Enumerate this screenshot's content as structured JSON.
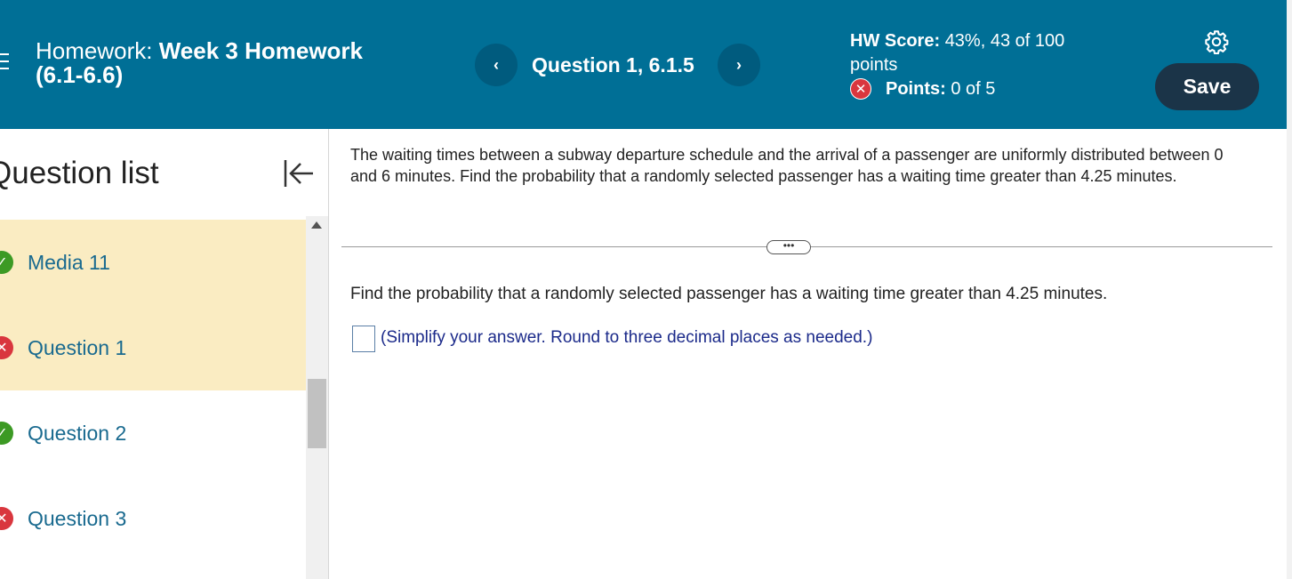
{
  "header": {
    "title_prefix": "Homework:",
    "title_name": "Week 3 Homework",
    "title_suffix": "(6.1-6.6)",
    "question_label": "Question 1, 6.1.5",
    "prev_symbol": "‹",
    "next_symbol": "›",
    "hw_score_label": "HW Score:",
    "hw_score_value": "43%, 43 of 100",
    "hw_score_unit": "points",
    "points_label": "Points:",
    "points_value": "0 of 5",
    "save_label": "Save",
    "colors": {
      "header_bg": "#006f96",
      "save_bg": "#1b3448",
      "error": "#d9363e"
    }
  },
  "sidebar": {
    "title": "Question list",
    "items": [
      {
        "label": "Media 11",
        "status": "correct",
        "active": true
      },
      {
        "label": "Question 1",
        "status": "incorrect",
        "active": true
      },
      {
        "label": "Question 2",
        "status": "correct",
        "active": false
      },
      {
        "label": "Question 3",
        "status": "incorrect",
        "active": false
      }
    ]
  },
  "main": {
    "question_text": "The waiting times between a subway departure schedule and the arrival of a passenger are uniformly distributed between 0 and 6 minutes. Find the probability that a randomly selected passenger has a waiting time greater than 4.25 minutes.",
    "more_symbol": "•••",
    "prompt": "Find the probability that a randomly selected passenger has a waiting time greater than 4.25 minutes.",
    "answer_value": "",
    "hint": "(Simplify your answer. Round to three decimal places as needed.)"
  }
}
